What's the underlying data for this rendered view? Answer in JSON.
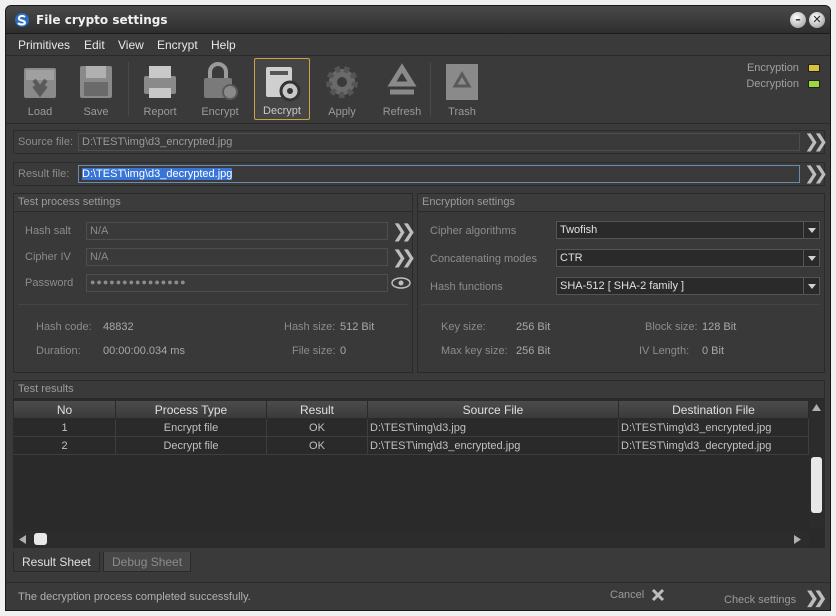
{
  "window": {
    "title": "File crypto settings"
  },
  "menu": [
    "Primitives",
    "Edit",
    "View",
    "Encrypt",
    "Help"
  ],
  "toolbar": {
    "load": "Load",
    "save": "Save",
    "report": "Report",
    "encrypt": "Encrypt",
    "decrypt": "Decrypt",
    "apply": "Apply",
    "refresh": "Refresh",
    "trash": "Trash"
  },
  "legend": {
    "encryption": "Encryption",
    "decryption": "Decryption",
    "encryption_color": "#d8c23a",
    "decryption_color": "#9bd83a"
  },
  "source": {
    "label": "Source file:",
    "value": "D:\\TEST\\img\\d3_encrypted.jpg"
  },
  "result": {
    "label": "Result file:",
    "value": "D:\\TEST\\img\\d3_decrypted.jpg"
  },
  "test_process": {
    "title": "Test process settings",
    "hash_salt_label": "Hash salt",
    "hash_salt": "N/A",
    "cipher_iv_label": "Cipher IV",
    "cipher_iv": "N/A",
    "password_label": "Password",
    "password": "●●●●●●●●●●●●●●●",
    "hash_code_label": "Hash code:",
    "hash_code": "48832",
    "duration_label": "Duration:",
    "duration": "00:00:00.034 ms",
    "hash_size_label": "Hash size:",
    "hash_size": "512 Bit",
    "file_size_label": "File size:",
    "file_size": "0"
  },
  "encryption_settings": {
    "title": "Encryption settings",
    "cipher_label": "Cipher algorithms",
    "cipher": "Twofish",
    "modes_label": "Concatenating modes",
    "mode": "CTR",
    "hash_label": "Hash functions",
    "hash": "SHA-512 [ SHA-2 family ]",
    "key_size_label": "Key size:",
    "key_size": "256 Bit",
    "max_key_label": "Max key size:",
    "max_key": "256 Bit",
    "block_size_label": "Block size:",
    "block_size": "128 Bit",
    "iv_length_label": "IV Length:",
    "iv_length": "0 Bit"
  },
  "results": {
    "title": "Test results",
    "columns": [
      "No",
      "Process Type",
      "Result",
      "Source File",
      "Destination File"
    ],
    "rows": [
      [
        "1",
        "Encrypt file",
        "OK",
        "D:\\TEST\\img\\d3.jpg",
        "D:\\TEST\\img\\d3_encrypted.jpg"
      ],
      [
        "2",
        "Decrypt file",
        "OK",
        "D:\\TEST\\img\\d3_encrypted.jpg",
        "D:\\TEST\\img\\d3_decrypted.jpg"
      ]
    ]
  },
  "tabs": [
    "Result Sheet",
    "Debug Sheet"
  ],
  "status": {
    "message": "The decryption process completed successfully.",
    "cancel": "Cancel",
    "check": "Check settings"
  }
}
